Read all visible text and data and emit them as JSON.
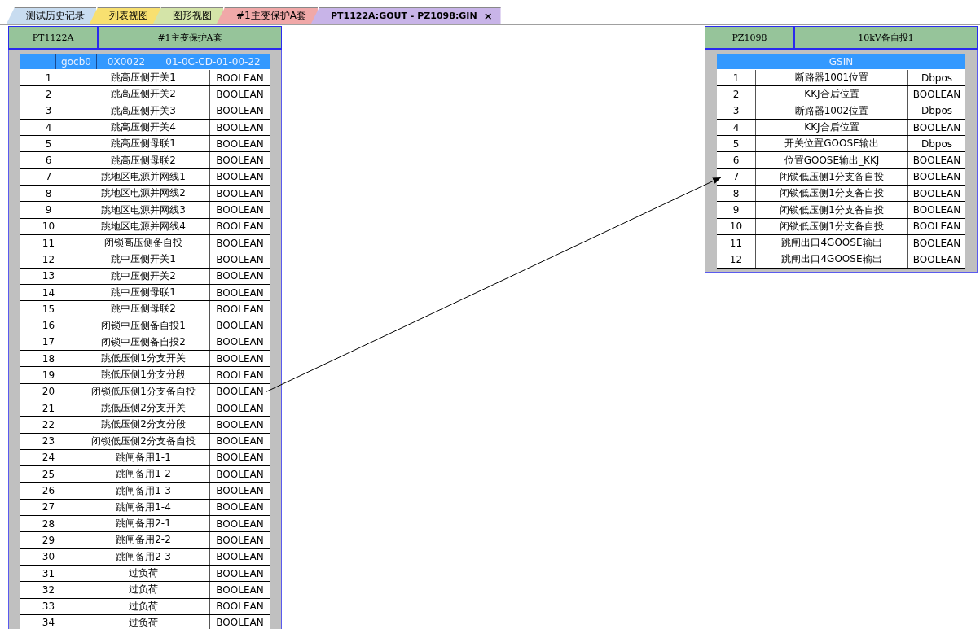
{
  "tabs": [
    {
      "label": "测试历史记录",
      "selected": false,
      "color": "#c8dcf0"
    },
    {
      "label": "列表视图",
      "selected": false,
      "color": "#f8e070"
    },
    {
      "label": "图形视图",
      "selected": false,
      "color": "#d4e4a8"
    },
    {
      "label": "#1主变保护A套",
      "selected": false,
      "color": "#f0a8a8"
    },
    {
      "label": "PT1122A:GOUT - PZ1098:GIN",
      "selected": true,
      "color": "#c8b4e8",
      "close": "×"
    }
  ],
  "source": {
    "device": "PT1122A",
    "name": "#1主变保护A套",
    "block": {
      "columns": [
        "gocb0",
        "0X0022",
        "01-0C-CD-01-00-22"
      ],
      "rows": [
        {
          "index": "1",
          "signal": "跳高压侧开关1",
          "type": "BOOLEAN",
          "linked": false
        },
        {
          "index": "2",
          "signal": "跳高压侧开关2",
          "type": "BOOLEAN",
          "linked": false
        },
        {
          "index": "3",
          "signal": "跳高压侧开关3",
          "type": "BOOLEAN",
          "linked": false
        },
        {
          "index": "4",
          "signal": "跳高压侧开关4",
          "type": "BOOLEAN",
          "linked": false
        },
        {
          "index": "5",
          "signal": "跳高压侧母联1",
          "type": "BOOLEAN",
          "linked": false
        },
        {
          "index": "6",
          "signal": "跳高压侧母联2",
          "type": "BOOLEAN",
          "linked": false
        },
        {
          "index": "7",
          "signal": "跳地区电源并网线1",
          "type": "BOOLEAN",
          "linked": false
        },
        {
          "index": "8",
          "signal": "跳地区电源并网线2",
          "type": "BOOLEAN",
          "linked": false
        },
        {
          "index": "9",
          "signal": "跳地区电源并网线3",
          "type": "BOOLEAN",
          "linked": false
        },
        {
          "index": "10",
          "signal": "跳地区电源并网线4",
          "type": "BOOLEAN",
          "linked": false
        },
        {
          "index": "11",
          "signal": "闭锁高压侧备自投",
          "type": "BOOLEAN",
          "linked": false
        },
        {
          "index": "12",
          "signal": "跳中压侧开关1",
          "type": "BOOLEAN",
          "linked": false
        },
        {
          "index": "13",
          "signal": "跳中压侧开关2",
          "type": "BOOLEAN",
          "linked": false
        },
        {
          "index": "14",
          "signal": "跳中压侧母联1",
          "type": "BOOLEAN",
          "linked": false
        },
        {
          "index": "15",
          "signal": "跳中压侧母联2",
          "type": "BOOLEAN",
          "linked": false
        },
        {
          "index": "16",
          "signal": "闭锁中压侧备自投1",
          "type": "BOOLEAN",
          "linked": false
        },
        {
          "index": "17",
          "signal": "闭锁中压侧备自投2",
          "type": "BOOLEAN",
          "linked": false
        },
        {
          "index": "18",
          "signal": "跳低压侧1分支开关",
          "type": "BOOLEAN",
          "linked": false
        },
        {
          "index": "19",
          "signal": "跳低压侧1分支分段",
          "type": "BOOLEAN",
          "linked": false
        },
        {
          "index": "20",
          "signal": "闭锁低压侧1分支备自投",
          "type": "BOOLEAN",
          "linked": true
        },
        {
          "index": "21",
          "signal": "跳低压侧2分支开关",
          "type": "BOOLEAN",
          "linked": false
        },
        {
          "index": "22",
          "signal": "跳低压侧2分支分段",
          "type": "BOOLEAN",
          "linked": false
        },
        {
          "index": "23",
          "signal": "闭锁低压侧2分支备自投",
          "type": "BOOLEAN",
          "linked": false
        },
        {
          "index": "24",
          "signal": "跳闸备用1-1",
          "type": "BOOLEAN",
          "linked": false
        },
        {
          "index": "25",
          "signal": "跳闸备用1-2",
          "type": "BOOLEAN",
          "linked": false
        },
        {
          "index": "26",
          "signal": "跳闸备用1-3",
          "type": "BOOLEAN",
          "linked": false
        },
        {
          "index": "27",
          "signal": "跳闸备用1-4",
          "type": "BOOLEAN",
          "linked": false
        },
        {
          "index": "28",
          "signal": "跳闸备用2-1",
          "type": "BOOLEAN",
          "linked": false
        },
        {
          "index": "29",
          "signal": "跳闸备用2-2",
          "type": "BOOLEAN",
          "linked": false
        },
        {
          "index": "30",
          "signal": "跳闸备用2-3",
          "type": "BOOLEAN",
          "linked": false
        },
        {
          "index": "31",
          "signal": "过负荷",
          "type": "BOOLEAN",
          "linked": false
        },
        {
          "index": "32",
          "signal": "过负荷",
          "type": "BOOLEAN",
          "linked": false
        },
        {
          "index": "33",
          "signal": "过负荷",
          "type": "BOOLEAN",
          "linked": false
        },
        {
          "index": "34",
          "signal": "过负荷",
          "type": "BOOLEAN",
          "linked": false
        }
      ]
    }
  },
  "target": {
    "device": "PZ1098",
    "name": "10kV备自投1",
    "block": {
      "title": "GSIN",
      "rows": [
        {
          "index": "1",
          "signal": "断路器1001位置",
          "type": "Dbpos",
          "linked": false
        },
        {
          "index": "2",
          "signal": "KKJ合后位置",
          "type": "BOOLEAN",
          "linked": false
        },
        {
          "index": "3",
          "signal": "断路器1002位置",
          "type": "Dbpos",
          "linked": false
        },
        {
          "index": "4",
          "signal": "KKJ合后位置",
          "type": "BOOLEAN",
          "linked": false
        },
        {
          "index": "5",
          "signal": "开关位置GOOSE输出",
          "type": "Dbpos",
          "linked": false
        },
        {
          "index": "6",
          "signal": "位置GOOSE输出_KKJ",
          "type": "BOOLEAN",
          "linked": false
        },
        {
          "index": "7",
          "signal": "闭锁低压侧1分支备自投",
          "type": "BOOLEAN",
          "linked": true
        },
        {
          "index": "8",
          "signal": "闭锁低压侧1分支备自投",
          "type": "BOOLEAN",
          "linked": false
        },
        {
          "index": "9",
          "signal": "闭锁低压侧1分支备自投",
          "type": "BOOLEAN",
          "linked": false
        },
        {
          "index": "10",
          "signal": "闭锁低压侧1分支备自投",
          "type": "BOOLEAN",
          "linked": false
        },
        {
          "index": "11",
          "signal": "跳闸出口4GOOSE输出",
          "type": "BOOLEAN",
          "linked": false
        },
        {
          "index": "12",
          "signal": "跳闸出口4GOOSE输出",
          "type": "BOOLEAN",
          "linked": false
        }
      ]
    }
  }
}
